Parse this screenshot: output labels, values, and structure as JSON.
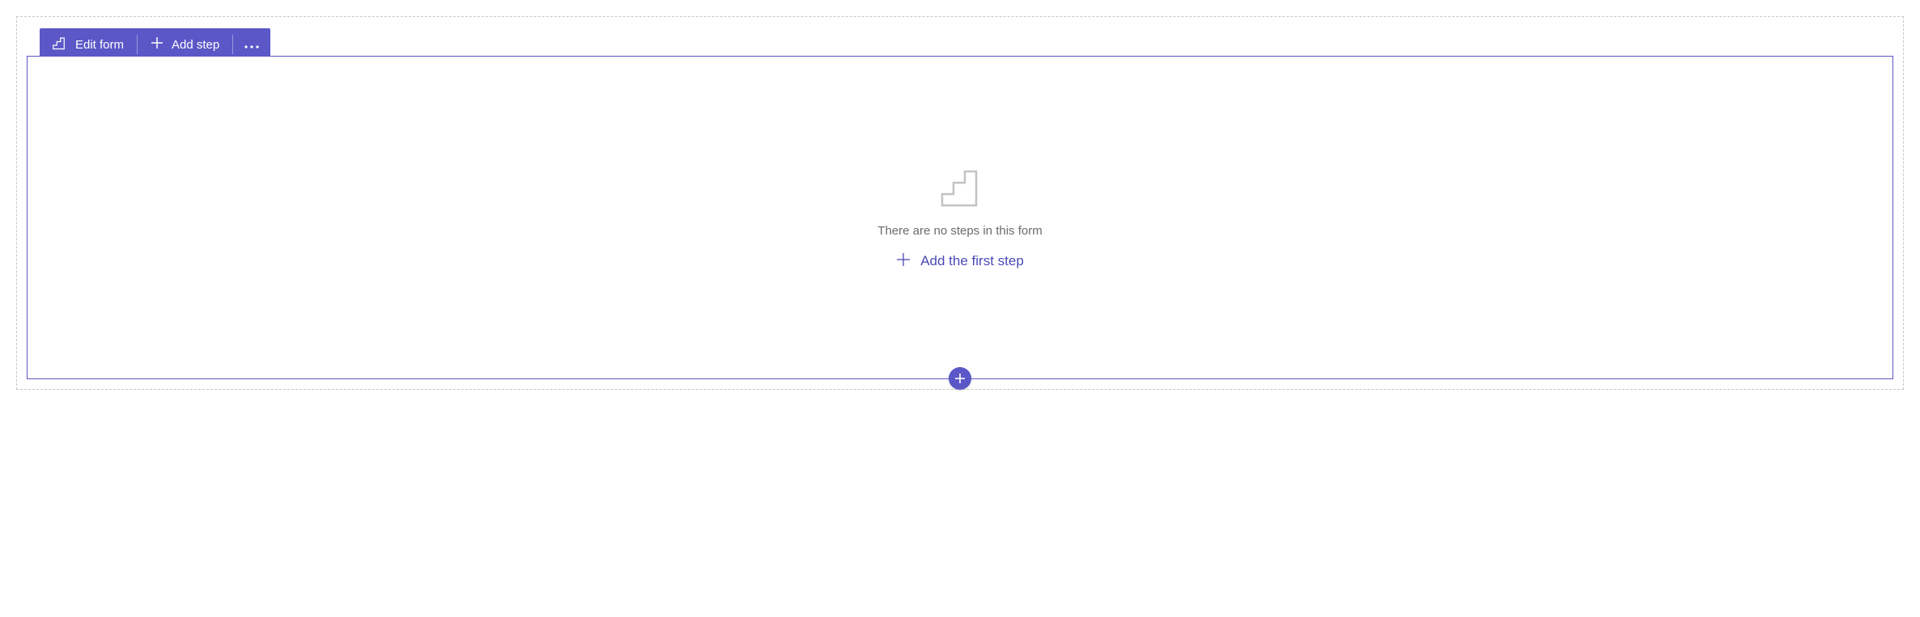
{
  "toolbar": {
    "edit_form_label": "Edit form",
    "add_step_label": "Add step"
  },
  "empty_state": {
    "message": "There are no steps in this form",
    "cta_label": "Add the first step"
  }
}
